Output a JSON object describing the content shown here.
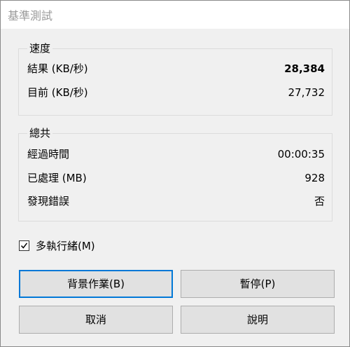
{
  "window": {
    "title": "基準測試"
  },
  "speed": {
    "label": "速度",
    "rows": [
      {
        "label": "結果 (KB/秒)",
        "value": "28,384"
      },
      {
        "label": "目前 (KB/秒)",
        "value": "27,732"
      }
    ]
  },
  "total": {
    "label": "總共",
    "rows": [
      {
        "label": "經過時間",
        "value": "00:00:35"
      },
      {
        "label": "已處理 (MB)",
        "value": "928"
      },
      {
        "label": "發現錯誤",
        "value": "否"
      }
    ]
  },
  "multithread": {
    "label": "多執行緒(M)",
    "checked": true
  },
  "buttons": {
    "background": "背景作業(B)",
    "pause": "暫停(P)",
    "cancel": "取消",
    "help": "說明"
  },
  "colors": {
    "accent": "#0078d7"
  }
}
